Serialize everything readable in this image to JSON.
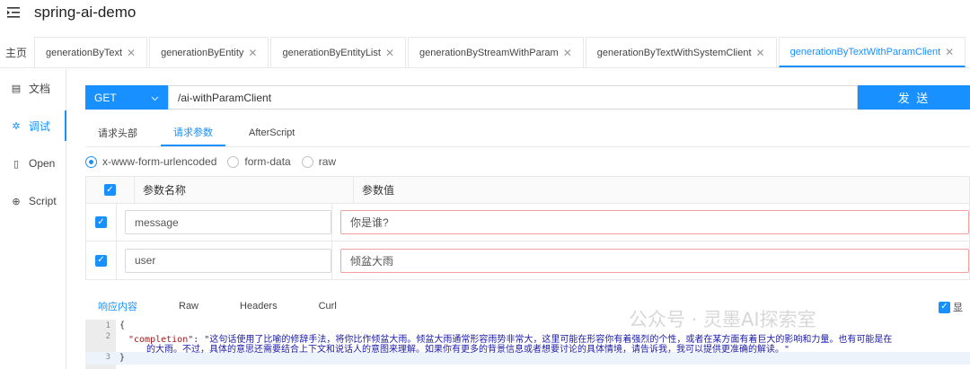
{
  "app": {
    "title": "spring-ai-demo"
  },
  "tabs": [
    {
      "label": "主页",
      "closable": false
    },
    {
      "label": "generationByText"
    },
    {
      "label": "generationByEntity"
    },
    {
      "label": "generationByEntityList"
    },
    {
      "label": "generationByStreamWithParam"
    },
    {
      "label": "generationByTextWithSystemClient"
    },
    {
      "label": "generationByTextWithParamClient",
      "active": true
    }
  ],
  "sidebar": {
    "items": [
      {
        "label": "文档",
        "icon": "doc-icon"
      },
      {
        "label": "调试",
        "icon": "debug-icon",
        "active": true
      },
      {
        "label": "Open",
        "icon": "file-icon"
      },
      {
        "label": "Script",
        "icon": "script-icon"
      }
    ]
  },
  "request": {
    "method": "GET",
    "url": "/ai-withParamClient",
    "send_label": "发 送",
    "tabs": [
      "请求头部",
      "请求参数",
      "AfterScript"
    ],
    "active_tab": "请求参数",
    "body_types": [
      "x-www-form-urlencoded",
      "form-data",
      "raw"
    ],
    "selected_body_type": "x-www-form-urlencoded"
  },
  "params": {
    "header_name": "参数名称",
    "header_value": "参数值",
    "rows": [
      {
        "name": "message",
        "value": "你是谁?"
      },
      {
        "name": "user",
        "value": "倾盆大雨"
      }
    ]
  },
  "response": {
    "tabs": [
      "响应内容",
      "Raw",
      "Headers",
      "Curl"
    ],
    "active_tab": "响应内容",
    "check_label": "显",
    "line_numbers": [
      "1",
      "2",
      "3"
    ],
    "lines": {
      "l1": "{",
      "l2_key": "\"completion\"",
      "l2_value": "\"这句话使用了比喻的修辞手法，将你比作倾盆大雨。倾盆大雨通常形容雨势非常大，这里可能在形容你有着强烈的个性，或者在某方面有着巨大的影响和力量。也有可能是在",
      "l2_cont": "的大雨。不过，具体的意思还需要结合上下文和说话人的意图来理解。如果你有更多的背景信息或者想要讨论的具体情境，请告诉我，我可以提供更准确的解读。\"",
      "l3": "}"
    }
  },
  "watermark": "公众号 · 灵墨AI探索室",
  "colors": {
    "accent": "#1890ff",
    "error_border": "#f3a0a0"
  }
}
